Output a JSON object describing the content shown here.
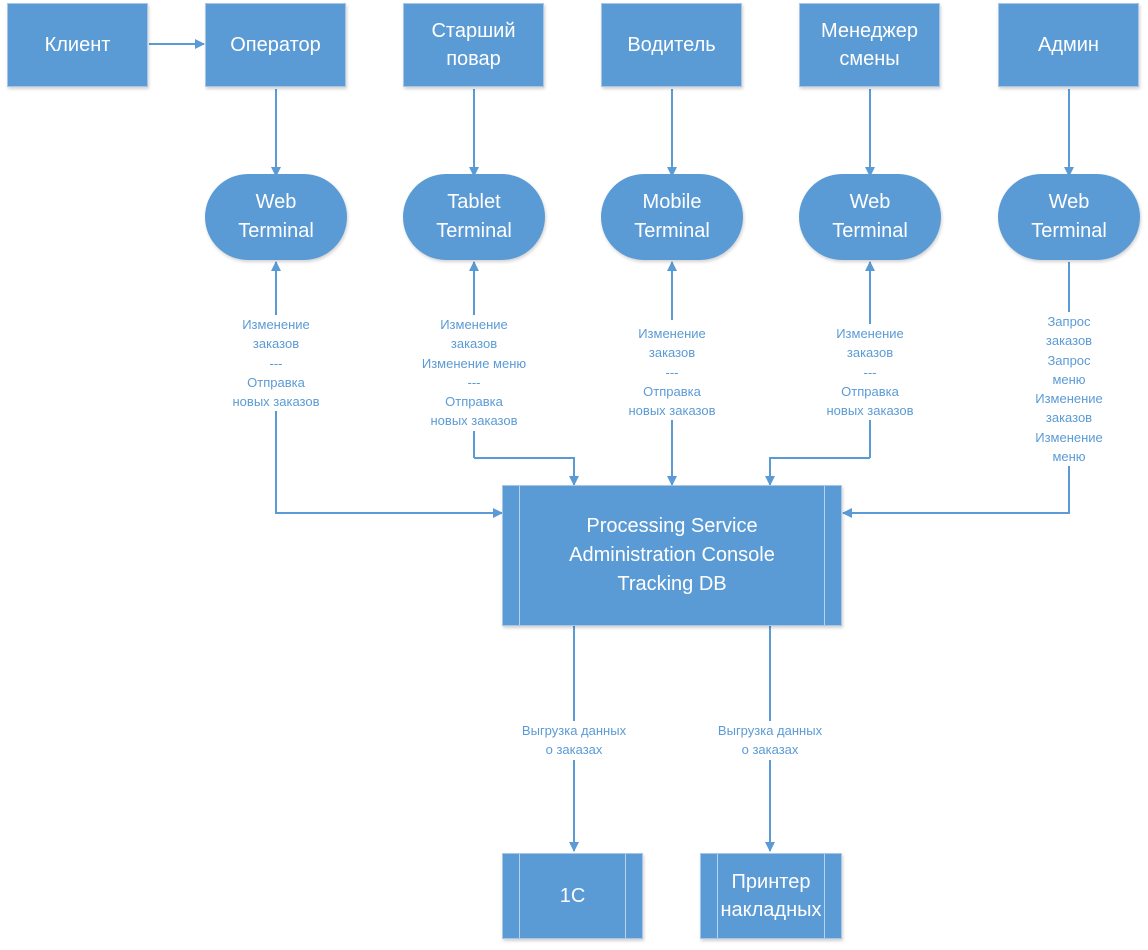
{
  "colors": {
    "node_fill": "#5B9BD5",
    "node_text": "#FFFFFF",
    "connector": "#5B9BD5",
    "label_text": "#5B9BD5"
  },
  "actors": {
    "client": "Клиент",
    "operator": "Оператор",
    "senior_cook": "Старший\nповар",
    "driver": "Водитель",
    "shift_manager": "Менеджер\nсмены",
    "admin": "Админ"
  },
  "terminals": {
    "operator_terminal": "Web\nTerminal",
    "cook_terminal": "Tablet\nTerminal",
    "driver_terminal": "Mobile\nTerminal",
    "manager_terminal": "Web\nTerminal",
    "admin_terminal": "Web\nTerminal"
  },
  "core": {
    "label": "Processing Service\nAdministration Console\nTracking DB"
  },
  "outputs": {
    "one_c": "1C",
    "printer": "Принтер\nнакладных"
  },
  "flow_labels": {
    "operator": "Изменение\nзаказов\n---\nОтправка\nновых заказов",
    "cook": "Изменение\nзаказов\nИзменение меню\n---\nОтправка\nновых заказов",
    "driver": "Изменение\nзаказов\n---\nОтправка\nновых заказов",
    "manager": "Изменение\nзаказов\n---\nОтправка\nновых заказов",
    "admin": "Запрос заказов\nЗапрос меню\nИзменение\nзаказов\nИзменение меню",
    "to_1c": "Выгрузка данных\nо заказах",
    "to_printer": "Выгрузка данных\nо заказах"
  }
}
